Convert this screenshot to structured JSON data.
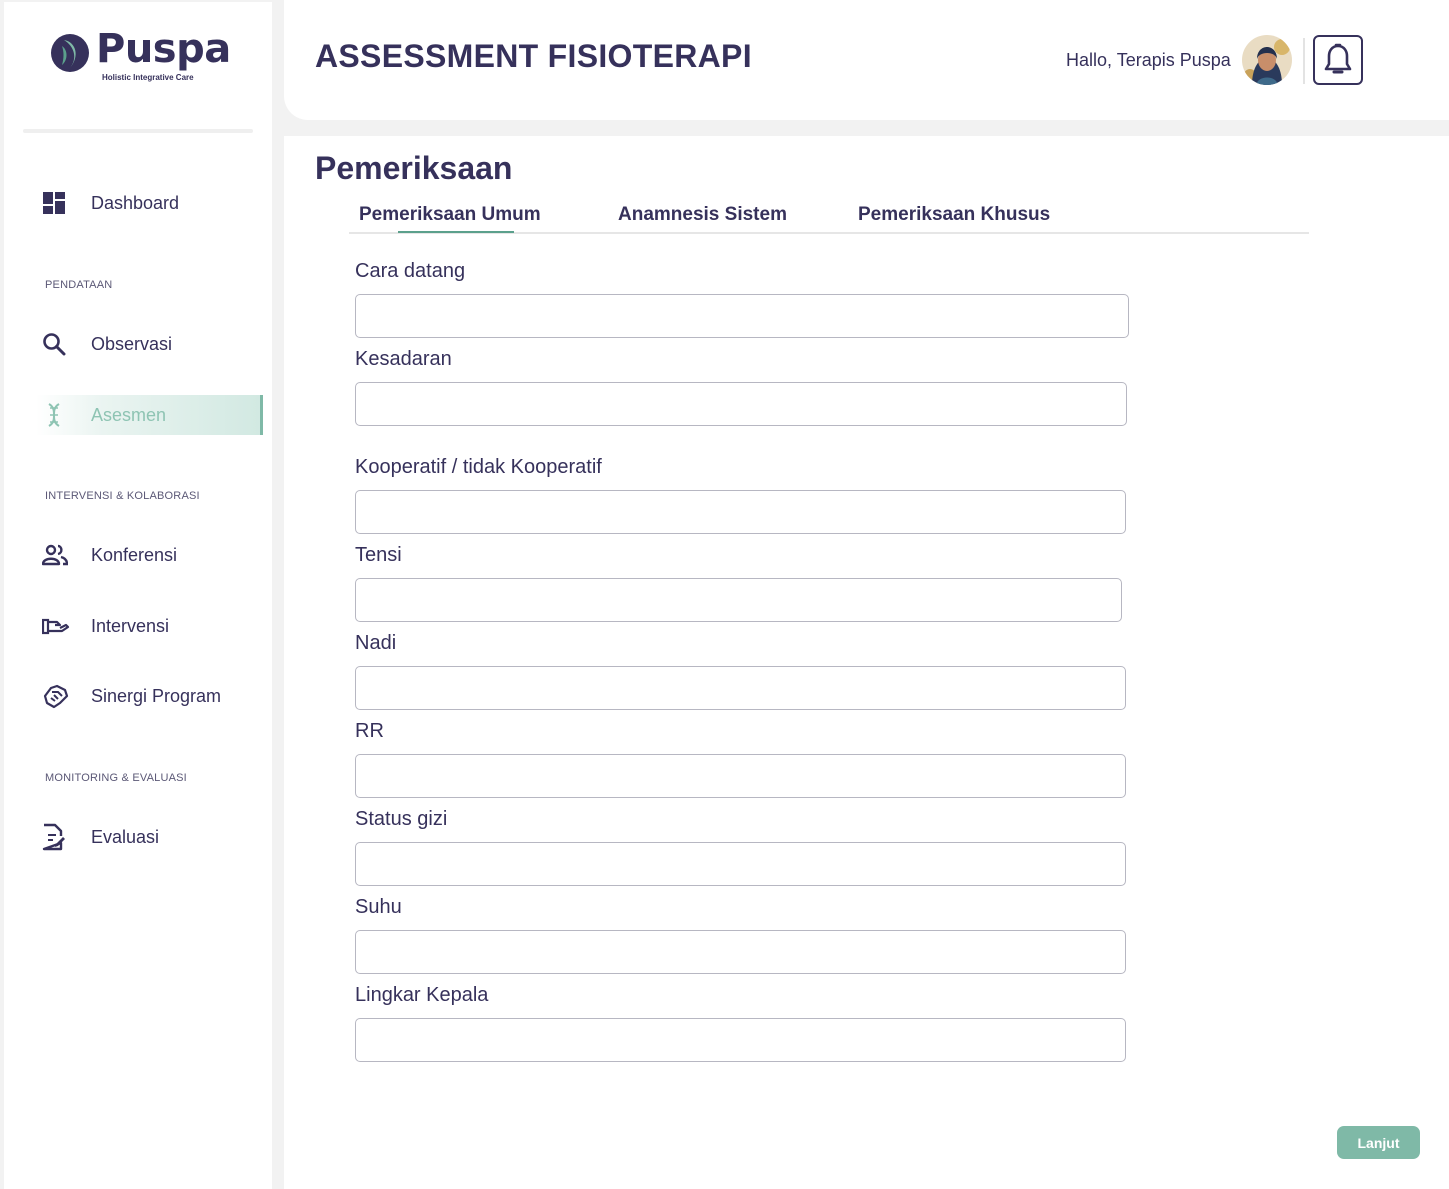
{
  "brand": {
    "name": "Puspa",
    "tagline": "Holistic Integrative Care"
  },
  "header": {
    "title": "ASSESSMENT FISIOTERAPI",
    "greeting": "Hallo, Terapis Puspa"
  },
  "sidebar": {
    "dashboard": {
      "label": "Dashboard",
      "icon": "dashboard-icon"
    },
    "sections": {
      "pendataan": "PENDATAAN",
      "intervensi": "INTERVENSI & KOLABORASI",
      "monitoring": "MONITORING & EVALUASI"
    },
    "items": {
      "observasi": {
        "label": "Observasi",
        "icon": "search-icon"
      },
      "asesmen": {
        "label": "Asesmen",
        "icon": "dna-icon",
        "active": true
      },
      "konferensi": {
        "label": "Konferensi",
        "icon": "people-icon"
      },
      "intervensi": {
        "label": "Intervensi",
        "icon": "hand-icon"
      },
      "sinergi": {
        "label": "Sinergi Program",
        "icon": "handshake-icon"
      },
      "evaluasi": {
        "label": "Evaluasi",
        "icon": "edit-document-icon"
      }
    }
  },
  "main": {
    "page_title": "Pemeriksaan",
    "tabs": [
      {
        "label": "Pemeriksaan Umum",
        "active": true
      },
      {
        "label": "Anamnesis Sistem",
        "active": false
      },
      {
        "label": "Pemeriksaan Khusus",
        "active": false
      }
    ],
    "fields": [
      {
        "label": "Cara datang",
        "value": ""
      },
      {
        "label": "Kesadaran",
        "value": ""
      },
      {
        "label": "Kooperatif / tidak Kooperatif",
        "value": ""
      },
      {
        "label": "Tensi",
        "value": ""
      },
      {
        "label": "Nadi",
        "value": ""
      },
      {
        "label": "RR",
        "value": ""
      },
      {
        "label": "Status gizi",
        "value": ""
      },
      {
        "label": "Suhu",
        "value": ""
      },
      {
        "label": "Lingkar Kepala",
        "value": ""
      }
    ],
    "next_button": "Lanjut"
  },
  "colors": {
    "primary": "#36315b",
    "accent": "#7fb9a7",
    "tab_underline": "#5ba08c",
    "background": "#f2f2f2"
  }
}
